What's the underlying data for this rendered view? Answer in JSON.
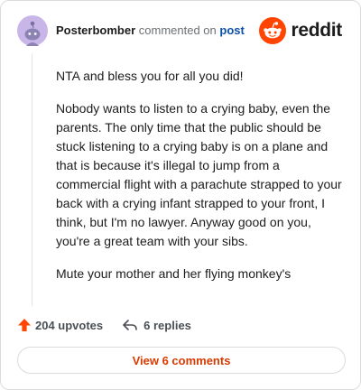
{
  "header": {
    "username": "Posterbomber",
    "action_text": "commented on",
    "post_link": "post",
    "brand": "reddit"
  },
  "comment": {
    "paragraphs": [
      "NTA and bless you for all you did!",
      "Nobody wants to listen to a crying baby, even the parents. The only time that the public should be stuck listening to a crying baby is on a plane and that is because it's illegal to jump from a commercial flight with a parachute strapped to your back with a crying infant strapped to your front, I think, but I'm no lawyer. Anyway good on you, you're a great team with your sibs.",
      "Mute your mother and her flying monkey's"
    ]
  },
  "actions": {
    "upvotes": "204 upvotes",
    "replies": "6 replies"
  },
  "footer": {
    "view_comments": "View 6 comments"
  },
  "colors": {
    "accent": "#ff4500",
    "link": "#0b4fa8",
    "view_button_text": "#d93a00",
    "avatar_bg": "#c9b6e8"
  }
}
